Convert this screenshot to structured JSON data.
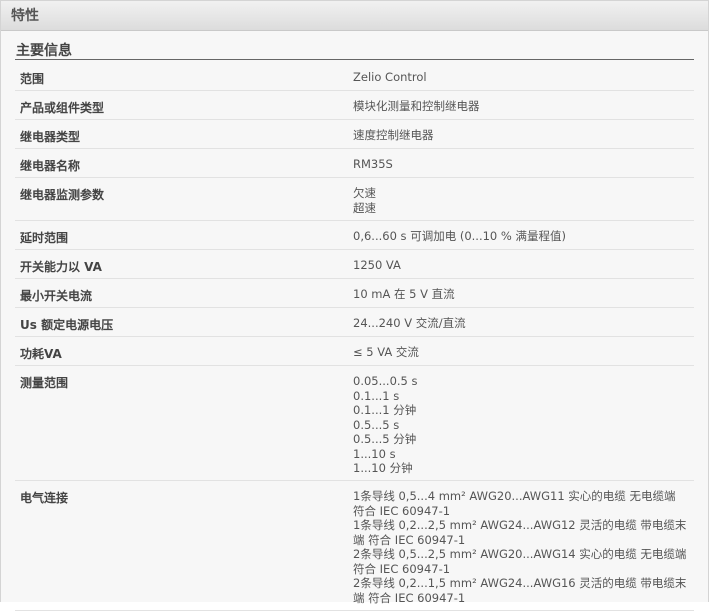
{
  "header": {
    "title": "特性"
  },
  "section": {
    "title": "主要信息"
  },
  "rows": [
    {
      "label": "范围",
      "values": [
        "Zelio Control"
      ]
    },
    {
      "label": "产品或组件类型",
      "values": [
        "模块化测量和控制继电器"
      ]
    },
    {
      "label": "继电器类型",
      "values": [
        "速度控制继电器"
      ]
    },
    {
      "label": "继电器名称",
      "values": [
        "RM35S"
      ]
    },
    {
      "label": "继电器监测参数",
      "values": [
        "欠速",
        "超速"
      ]
    },
    {
      "label": "延时范围",
      "values": [
        "0,6...60 s 可调加电 (0...10 % 满量程值)"
      ]
    },
    {
      "label": "开关能力以 VA",
      "values": [
        "1250 VA"
      ]
    },
    {
      "label": "最小开关电流",
      "values": [
        "10 mA 在 5 V 直流"
      ]
    },
    {
      "label": "Us 额定电源电压",
      "values": [
        "24...240 V 交流/直流"
      ]
    },
    {
      "label": "功耗VA",
      "values": [
        "≤ 5 VA 交流"
      ]
    },
    {
      "label": "测量范围",
      "values": [
        "0.05...0.5 s",
        "0.1...1 s",
        "0.1...1 分钟",
        "0.5...5 s",
        "0.5...5 分钟",
        "1...10 s",
        "1...10 分钟"
      ]
    },
    {
      "label": "电气连接",
      "values": [
        "1条导线 0,5...4 mm² AWG20...AWG11 实心的电缆 无电缆端",
        "符合 IEC 60947-1",
        "1条导线 0,2...2,5 mm² AWG24...AWG12 灵活的电缆 带电缆末",
        "端 符合 IEC 60947-1",
        "2条导线 0,5...2,5 mm² AWG20...AWG14 实心的电缆 无电缆端",
        "符合 IEC 60947-1",
        "2条导线 0,2...1,5 mm² AWG24...AWG16 灵活的电缆 带电缆末",
        "端 符合 IEC 60947-1"
      ]
    }
  ]
}
